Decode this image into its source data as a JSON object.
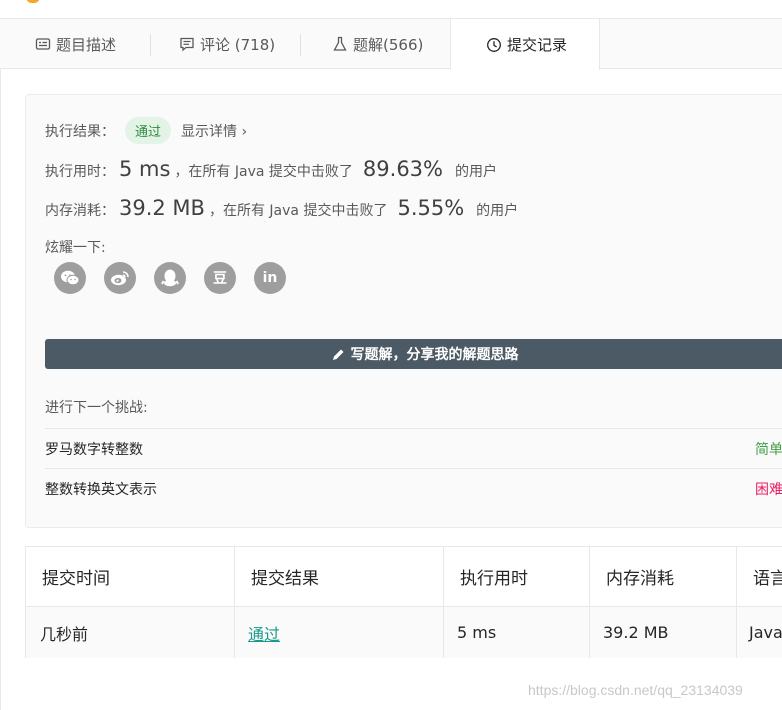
{
  "tabs": [
    {
      "label": "题目描述",
      "icon": "description-icon"
    },
    {
      "label": "评论 (718)",
      "icon": "comment-icon"
    },
    {
      "label": "题解(566)",
      "icon": "flask-icon"
    },
    {
      "label": "提交记录",
      "icon": "clock-icon"
    }
  ],
  "result": {
    "label": "执行结果：",
    "status": "通过",
    "detail_link": "显示详情 ›"
  },
  "runtime": {
    "label": "执行用时：",
    "value": "5 ms",
    "mid": "，在所有 Java 提交中击败了",
    "percent": "89.63%",
    "suffix": "的用户"
  },
  "memory": {
    "label": "内存消耗：",
    "value": "39.2 MB",
    "mid": "，在所有 Java 提交中击败了",
    "percent": "5.55%",
    "suffix": "的用户"
  },
  "share": {
    "label": "炫耀一下:",
    "icons": [
      "wechat-icon",
      "weibo-icon",
      "qq-icon",
      "douban-icon",
      "linkedin-icon"
    ],
    "douban_glyph": "豆",
    "linkedin_glyph": "in"
  },
  "write_button": "写题解，分享我的解题思路",
  "next": {
    "label": "进行下一个挑战:",
    "items": [
      {
        "title": "罗马数字转整数",
        "difficulty": "简单"
      },
      {
        "title": "整数转换英文表示",
        "difficulty": "困难"
      }
    ]
  },
  "colors": {
    "easy": "#43a047",
    "hard": "#e91e63",
    "accepted": "#1a9b8a",
    "button": "#4b5a64"
  },
  "table": {
    "headers": [
      "提交时间",
      "提交结果",
      "执行用时",
      "内存消耗",
      "语言"
    ],
    "row": [
      "几秒前",
      "通过",
      "5 ms",
      "39.2 MB",
      "Java"
    ]
  },
  "watermark": "https://blog.csdn.net/qq_23134039"
}
